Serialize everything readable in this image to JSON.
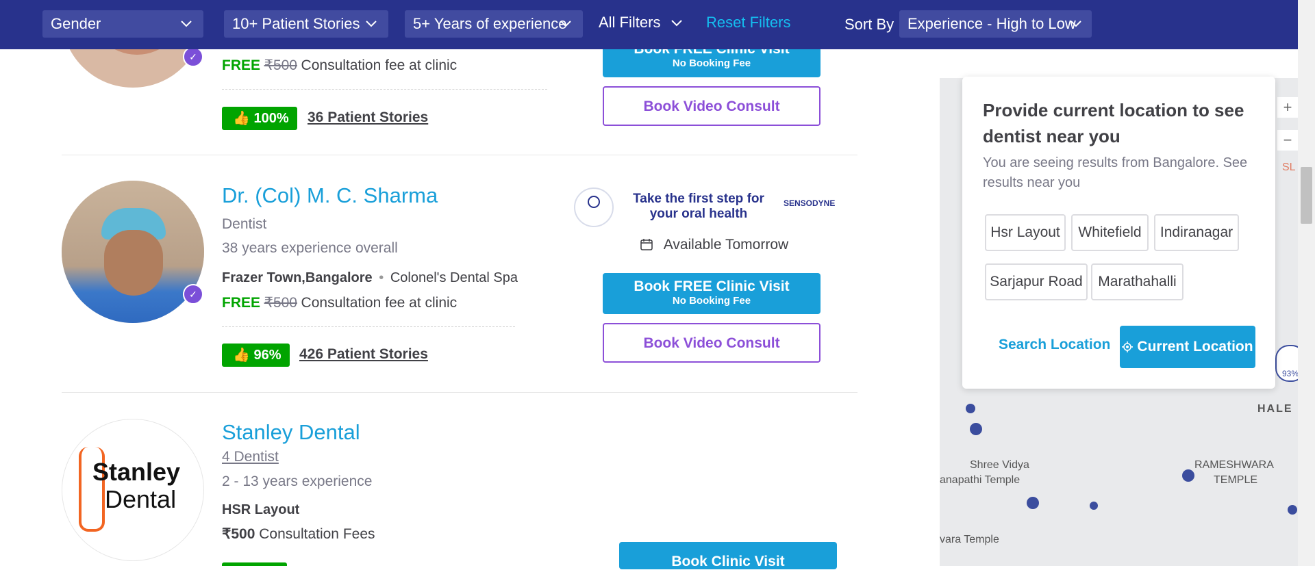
{
  "filters": {
    "gender": "Gender",
    "patient_stories": "10+ Patient Stories",
    "experience": "5+ Years of experience",
    "all_filters": "All Filters",
    "reset": "Reset Filters",
    "sort_label": "Sort By",
    "sort_value": "Experience - High to Low"
  },
  "card1": {
    "free": "FREE",
    "fee_old": "₹500",
    "fee_text": "Consultation fee at clinic",
    "rating": "100%",
    "stories": "36 Patient Stories",
    "btn_clinic_l1": "Book FREE Clinic Visit",
    "btn_clinic_l2": "No Booking Fee",
    "btn_video": "Book Video Consult"
  },
  "card2": {
    "name": "Dr. (Col) M. C. Sharma",
    "specialty": "Dentist",
    "experience": "38 years experience overall",
    "location": "Frazer Town,Bangalore",
    "clinic": "Colonel's Dental Spa",
    "free": "FREE",
    "fee_old": "₹500",
    "fee_text": "Consultation fee at clinic",
    "rating": "96%",
    "stories": "426 Patient Stories",
    "promo_text": "Take the first step for your oral health",
    "promo_brand": "SENSODYNE",
    "availability": "Available Tomorrow",
    "btn_clinic_l1": "Book FREE Clinic Visit",
    "btn_clinic_l2": "No Booking Fee",
    "btn_video": "Book Video Consult"
  },
  "card3": {
    "name": "Stanley Dental",
    "dentist_count": "4 Dentist",
    "experience": "2 - 13 years experience",
    "location": "HSR Layout",
    "fee": "₹500",
    "fee_text": "Consultation Fees",
    "logo_line1": "Stanley",
    "logo_line2": "Dental",
    "btn_clinic": "Book Clinic Visit"
  },
  "popup": {
    "title": "Provide current location to see dentist near you",
    "subtitle": "You are seeing results from Bangalore. See results near you",
    "chips": [
      "Hsr Layout",
      "Whitefield",
      "Indiranagar",
      "Sarjapur Road",
      "Marathahalli"
    ],
    "search_location": "Search Location",
    "current_location": "Current Location"
  },
  "map": {
    "labels": [
      "Shree Vidya",
      "anapathi Temple",
      "RAMESHWARA",
      "TEMPLE",
      "vara Temple",
      "HALE",
      "SL",
      "93%"
    ],
    "zoom_in": "+",
    "zoom_out": "−"
  },
  "colors": {
    "nav_bg": "#28328c",
    "accent_blue": "#199fd9",
    "rating_green": "#01a400",
    "video_purple": "#8c4fd8"
  }
}
